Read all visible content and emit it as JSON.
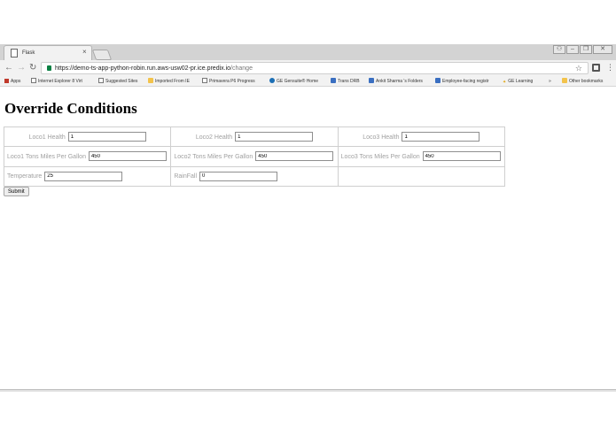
{
  "browser": {
    "tab_title": "Flask",
    "tab_close": "×",
    "window_controls": [
      "⚇",
      "‒",
      "❐",
      "✕"
    ],
    "url_prefix": "https://demo-ts-app-python-robin.run.aws-usw02-pr.ice.predix.io",
    "url_path": "/change",
    "bookmarks": [
      {
        "label": "Apps",
        "icon": "apps-icon"
      },
      {
        "label": "Internet Explorer 8 Virt",
        "icon": "page-icon"
      },
      {
        "label": "Suggested Sites",
        "icon": "page-icon"
      },
      {
        "label": "Imported From IE",
        "icon": "folder-icon"
      },
      {
        "label": "Primavera P6 Progress",
        "icon": "page-icon"
      },
      {
        "label": "GE Gensuite® Home",
        "icon": "ge-icon"
      },
      {
        "label": "Trans DRB",
        "icon": "blue-square-icon"
      },
      {
        "label": "Ankit Sharma 's Folders",
        "icon": "blue-square-icon"
      },
      {
        "label": "Employee-facing registr",
        "icon": "blue-square-icon"
      },
      {
        "label": "GE Learning",
        "icon": "spark-icon"
      },
      {
        "label": "»",
        "icon": ""
      },
      {
        "label": "Other bookmarks",
        "icon": "folder-icon"
      }
    ]
  },
  "page": {
    "heading": "Override Conditions",
    "rows": [
      [
        {
          "label": "Loco1 Health",
          "value": "1"
        },
        {
          "label": "Loco2 Health",
          "value": "1"
        },
        {
          "label": "Loco3 Health",
          "value": "1"
        }
      ],
      [
        {
          "label": "Loco1 Tons Miles Per Gallon",
          "value": "450"
        },
        {
          "label": "Loco2 Tons Miles Per Gallon",
          "value": "450"
        },
        {
          "label": "Loco3 Tons Miles Per Gallon",
          "value": "450"
        }
      ],
      [
        {
          "label": "Temperature",
          "value": "25"
        },
        {
          "label": "RainFall",
          "value": "0"
        }
      ]
    ],
    "submit_label": "Submit"
  }
}
